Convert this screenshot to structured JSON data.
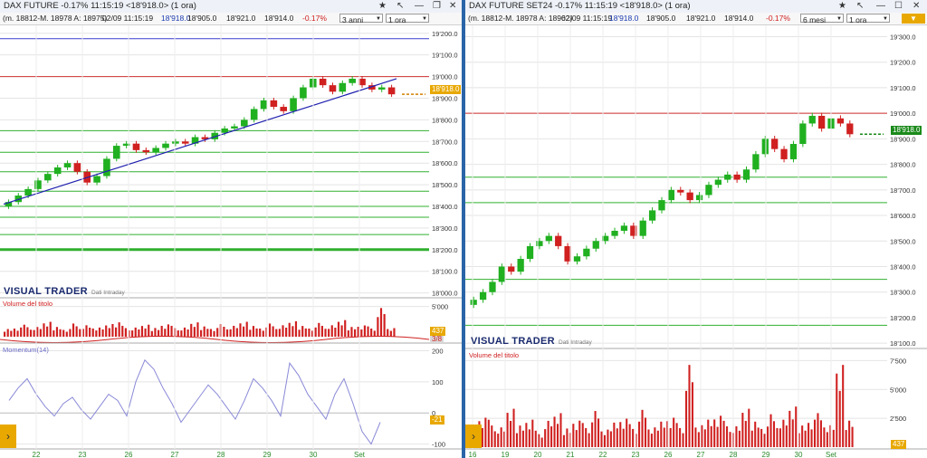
{
  "left": {
    "title": "DAX FUTURE -0.17% 11:15:19  <18'918.0> (1 ora)",
    "info": {
      "mma": "(m. 18812-M. 18978 A: 18975)",
      "datetime": "02/09 11:15:19",
      "price": "18'918.0",
      "open": "18'905.0",
      "high": "18'921.0",
      "low": "18'914.0",
      "change": "-0.17%"
    },
    "period_select": "3 anni",
    "interval_select": "1 ora",
    "price_tag": "18'918.0",
    "logo": "VISUAL TRADER",
    "logo_sub": "Dati Intraday",
    "volume_label": "Volume del titolo",
    "volume_tag": "437",
    "volume_tag2": "3/8",
    "momentum_label": "Momentum(14)",
    "momentum_tag": "-21",
    "colors": {
      "up": "#20b020",
      "down": "#d02020",
      "trend": "#2020b0",
      "support": "#30b030",
      "resistance": "#d03030",
      "momentum": "#8a8ad8"
    }
  },
  "right": {
    "title": "DAX FUTURE SET24 -0.17% 11:15:19  <18'918.0> (1 ora)",
    "info": {
      "mma": "(m. 18812-M. 18978 A: 18962)",
      "datetime": "02/09 11:15:19",
      "price": "18'918.0",
      "open": "18'905.0",
      "high": "18'921.0",
      "low": "18'914.0",
      "change": "-0.17%"
    },
    "period_select": "6 mesi",
    "interval_select": "1 ora",
    "price_tag": "18'918.0",
    "logo": "VISUAL TRADER",
    "logo_sub": "Dati Intraday",
    "volume_label": "Volume del titolo",
    "volume_tag": "437"
  },
  "chart_data": [
    {
      "type": "candlestick",
      "panel": "left-price",
      "x_labels": [
        "22",
        "23",
        "26",
        "27",
        "28",
        "29",
        "30",
        "Set"
      ],
      "y_ticks": [
        "19'200.0",
        "19'100.0",
        "19'000.0",
        "18'900.0",
        "18'800.0",
        "18'700.0",
        "18'600.0",
        "18'500.0",
        "18'400.0",
        "18'300.0",
        "18'200.0",
        "18'100.0",
        "18'000.0"
      ],
      "ylim": [
        17990,
        19220
      ],
      "close_path": [
        18420,
        18450,
        18480,
        18520,
        18550,
        18580,
        18600,
        18560,
        18510,
        18540,
        18620,
        18680,
        18690,
        18660,
        18650,
        18670,
        18690,
        18700,
        18690,
        18720,
        18710,
        18740,
        18760,
        18770,
        18800,
        18850,
        18890,
        18860,
        18840,
        18900,
        18950,
        18990,
        18960,
        18930,
        18970,
        18990,
        18960,
        18940,
        18950,
        18918
      ],
      "horizontal_levels": {
        "resistance": [
          19000
        ],
        "support": [
          18750,
          18650,
          18560,
          18470,
          18400,
          18350,
          18270,
          18200
        ],
        "blue": [
          19175
        ]
      },
      "trendline": [
        [
          0,
          18410
        ],
        [
          39,
          18990
        ]
      ]
    },
    {
      "type": "bar",
      "panel": "left-volume",
      "y_ticks": [
        "5'000"
      ],
      "values": [
        1500,
        1800,
        2100,
        1700,
        2600,
        1900,
        1500,
        2300,
        2000,
        1600,
        2200,
        2800,
        1900,
        1600,
        2100,
        1700,
        2400,
        1900,
        1600,
        2500,
        2000,
        1700,
        2200,
        1900,
        2600,
        2100,
        1800,
        2300,
        2000,
        2700,
        2100,
        1800,
        2400,
        2000,
        2900,
        1900,
        2200,
        1800,
        5000,
        1500
      ],
      "ylim": [
        0,
        6000
      ]
    },
    {
      "type": "line",
      "panel": "left-momentum",
      "y_ticks": [
        "200",
        "100",
        "0",
        "-100"
      ],
      "ylim": [
        -110,
        210
      ],
      "values": [
        40,
        80,
        110,
        60,
        20,
        -10,
        30,
        50,
        10,
        -20,
        20,
        60,
        40,
        -10,
        100,
        170,
        140,
        80,
        30,
        -30,
        10,
        50,
        90,
        60,
        20,
        -20,
        40,
        110,
        80,
        40,
        -10,
        160,
        120,
        60,
        20,
        -20,
        60,
        110,
        30,
        -60,
        -100,
        -30
      ]
    },
    {
      "type": "candlestick",
      "panel": "right-price",
      "x_labels": [
        "16",
        "19",
        "20",
        "21",
        "22",
        "23",
        "26",
        "27",
        "28",
        "29",
        "30",
        "Set"
      ],
      "y_ticks": [
        "19'300.0",
        "19'200.0",
        "19'100.0",
        "19'000.0",
        "18'900.0",
        "18'800.0",
        "18'700.0",
        "18'600.0",
        "18'500.0",
        "18'400.0",
        "18'300.0",
        "18'200.0",
        "18'100.0"
      ],
      "ylim": [
        18090,
        19330
      ],
      "close_path": [
        18270,
        18300,
        18340,
        18400,
        18380,
        18430,
        18480,
        18500,
        18520,
        18480,
        18420,
        18440,
        18470,
        18500,
        18520,
        18540,
        18560,
        18520,
        18580,
        18620,
        18660,
        18700,
        18690,
        18660,
        18680,
        18720,
        18740,
        18760,
        18740,
        18780,
        18840,
        18900,
        18860,
        18820,
        18880,
        18960,
        18990,
        18940,
        18980,
        18960,
        18918
      ],
      "horizontal_levels": {
        "resistance": [
          19000
        ],
        "support": [
          18750,
          18650,
          18350,
          18170
        ]
      }
    },
    {
      "type": "bar",
      "panel": "right-volume",
      "y_ticks": [
        "7'500",
        "5'000",
        "2'500"
      ],
      "ylim": [
        0,
        8000
      ],
      "values": [
        2000,
        3000,
        2500,
        1800,
        3500,
        2200,
        2800,
        1500,
        2400,
        3100,
        1900,
        2700,
        2200,
        3300,
        1600,
        2500,
        2900,
        2100,
        3400,
        1800,
        2600,
        3000,
        2200,
        7500,
        2000,
        2800,
        3200,
        2400,
        1900,
        3500,
        2600,
        2100,
        3000,
        2500,
        3700,
        2200,
        2800,
        3100,
        2000,
        7500,
        2700
      ]
    }
  ]
}
